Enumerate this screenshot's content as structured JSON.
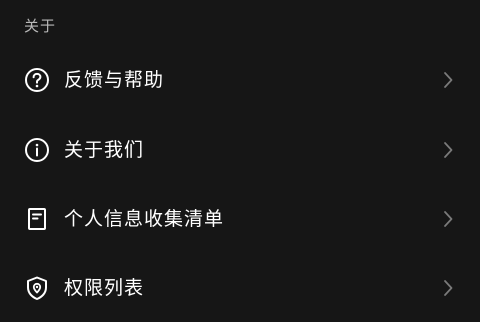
{
  "section": {
    "title": "关于"
  },
  "menu": {
    "items": [
      {
        "label": "反馈与帮助",
        "icon": "question-circle-icon"
      },
      {
        "label": "关于我们",
        "icon": "info-circle-icon"
      },
      {
        "label": "个人信息收集清单",
        "icon": "document-icon"
      },
      {
        "label": "权限列表",
        "icon": "shield-location-icon"
      }
    ]
  },
  "colors": {
    "background": "#161616",
    "text": "#ffffff",
    "section_title": "#b8b8b8",
    "chevron": "#7a7a7a"
  }
}
